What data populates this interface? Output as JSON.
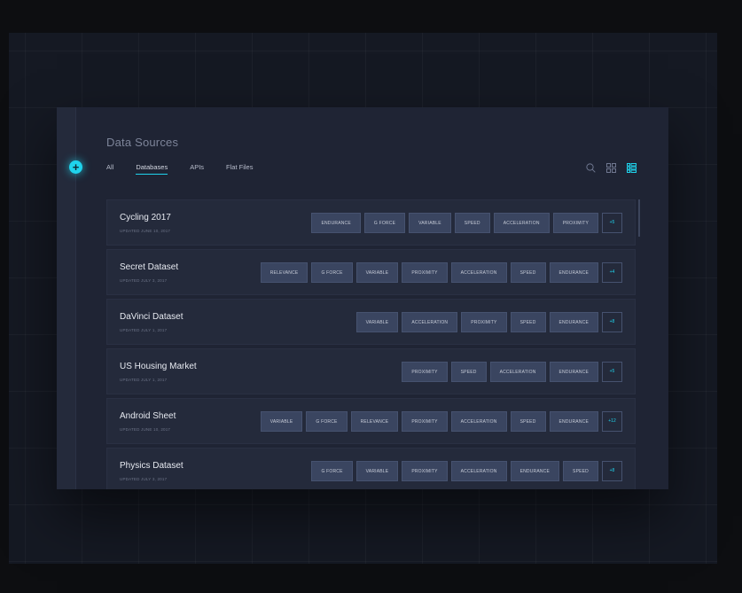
{
  "header": {
    "title": "Data Sources"
  },
  "tabs": [
    {
      "label": "All"
    },
    {
      "label": "Databases"
    },
    {
      "label": "APIs"
    },
    {
      "label": "Flat Files"
    }
  ],
  "active_tab": "Databases",
  "icons": {
    "add": "+",
    "search": "search-icon",
    "grid_view": "grid-view-icon",
    "list_view": "list-view-icon"
  },
  "colors": {
    "accent": "#1fd3ec",
    "panel": "#1f2434",
    "row": "#242a3b",
    "tag": "#3a4560"
  },
  "datasets": [
    {
      "name": "Cycling 2017",
      "updated": "UPDATED JUNE 10, 2017",
      "tags": [
        "ENDURANCE",
        "G FORCE",
        "VARIABLE",
        "SPEED",
        "ACCELERATION",
        "PROXIMITY"
      ],
      "more": "+5"
    },
    {
      "name": "Secret Dataset",
      "updated": "UPDATED JULY 3, 2017",
      "tags": [
        "RELEVANCE",
        "G FORCE",
        "VARIABLE",
        "PROXIMITY",
        "ACCELERATION",
        "SPEED",
        "ENDURANCE"
      ],
      "more": "+4"
    },
    {
      "name": "DaVinci Dataset",
      "updated": "UPDATED JULY 1, 2017",
      "tags": [
        "VARIABLE",
        "ACCELERATION",
        "PROXIMITY",
        "SPEED",
        "ENDURANCE"
      ],
      "more": "+8"
    },
    {
      "name": "US Housing Market",
      "updated": "UPDATED JULY 1, 2017",
      "tags": [
        "PROXIMITY",
        "SPEED",
        "ACCELERATION",
        "ENDURANCE"
      ],
      "more": "+5"
    },
    {
      "name": "Android Sheet",
      "updated": "UPDATED JUNE 10, 2017",
      "tags": [
        "VARIABLE",
        "G FORCE",
        "RELEVANCE",
        "PROXIMITY",
        "ACCELERATION",
        "SPEED",
        "ENDURANCE"
      ],
      "more": "+12"
    },
    {
      "name": "Physics Dataset",
      "updated": "UPDATED JULY 3, 2017",
      "tags": [
        "G FORCE",
        "VARIABLE",
        "PROXIMITY",
        "ACCELERATION",
        "ENDURANCE",
        "SPEED"
      ],
      "more": "+8"
    }
  ]
}
